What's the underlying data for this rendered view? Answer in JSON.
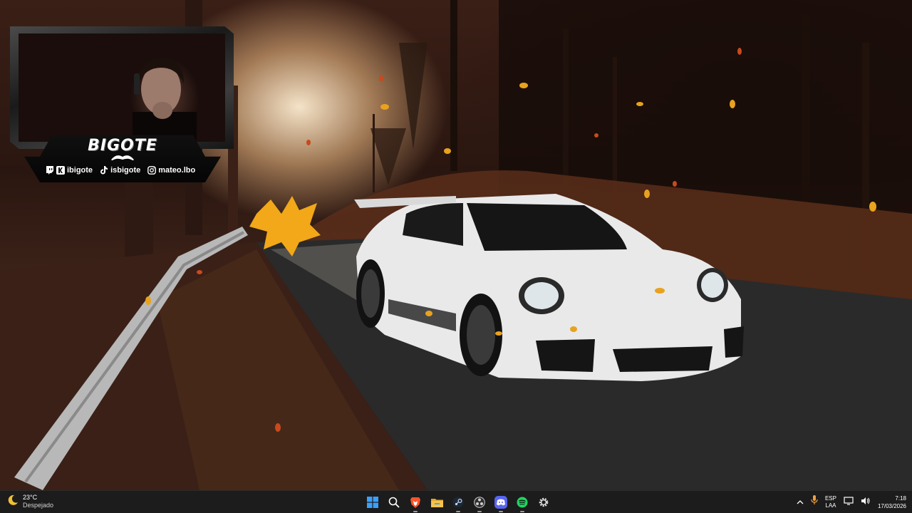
{
  "overlay": {
    "brand_name": "BIGOTE",
    "socials": [
      {
        "icon": "twitch-icon",
        "handle": "ibigote"
      },
      {
        "icon": "kick-icon",
        "handle": ""
      },
      {
        "icon": "tiktok-icon",
        "handle": "isbigote"
      },
      {
        "icon": "instagram-icon",
        "handle": "mateo.lbo"
      }
    ]
  },
  "taskbar": {
    "weather": {
      "icon": "moon-icon",
      "temperature": "23°C",
      "condition": "Despejado"
    },
    "apps": [
      {
        "name": "start-button",
        "icon": "windows-logo-icon"
      },
      {
        "name": "search-button",
        "icon": "search-icon"
      },
      {
        "name": "brave-browser",
        "icon": "brave-icon"
      },
      {
        "name": "file-explorer",
        "icon": "folder-icon"
      },
      {
        "name": "steam",
        "icon": "steam-icon"
      },
      {
        "name": "obs-studio",
        "icon": "obs-icon"
      },
      {
        "name": "discord",
        "icon": "discord-icon"
      },
      {
        "name": "spotify",
        "icon": "spotify-icon"
      },
      {
        "name": "settings",
        "icon": "gear-icon"
      }
    ],
    "tray": {
      "language_line1": "ESP",
      "language_line2": "LAA",
      "time": "7:18",
      "date": "17/03/2026"
    }
  },
  "colors": {
    "taskbar_bg": "#1c1c1c",
    "twitch": "#9146ff",
    "brave": "#fb542b",
    "folder": "#f4c34f",
    "discord": "#5865f2",
    "spotify": "#1ed760",
    "start": "#3aa0ff"
  }
}
